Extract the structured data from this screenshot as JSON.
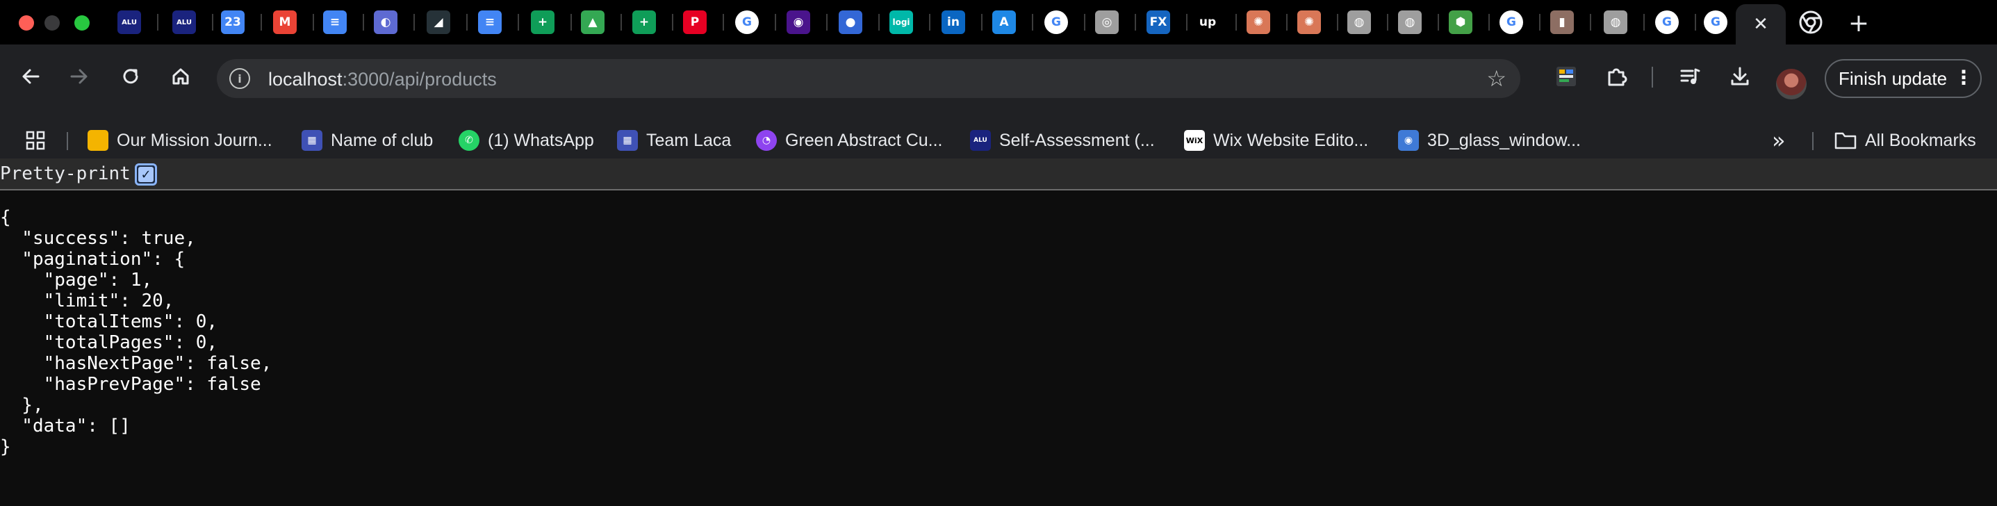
{
  "tabs": {
    "favicons": [
      {
        "icon": "alu-tab-icon",
        "glyph": "ALU",
        "color": "#1a237e"
      },
      {
        "icon": "alu-tab-icon",
        "glyph": "ALU",
        "color": "#1a237e"
      },
      {
        "icon": "calendar-tab-icon",
        "glyph": "23",
        "color": "#4285f4"
      },
      {
        "icon": "gmail-tab-icon",
        "glyph": "M",
        "color": "#ea4335"
      },
      {
        "icon": "docs-tab-icon",
        "glyph": "≡",
        "color": "#4285f4"
      },
      {
        "icon": "linear-tab-icon",
        "glyph": "◐",
        "color": "#5e6ad2"
      },
      {
        "icon": "alu-tab-icon",
        "glyph": "◢",
        "color": "#263238"
      },
      {
        "icon": "docs-tab-icon",
        "glyph": "≡",
        "color": "#4285f4"
      },
      {
        "icon": "sheets-tab-icon",
        "glyph": "+",
        "color": "#0f9d58"
      },
      {
        "icon": "drive-tab-icon",
        "glyph": "▲",
        "color": "#34a853"
      },
      {
        "icon": "sheets-tab-icon",
        "glyph": "+",
        "color": "#0f9d58"
      },
      {
        "icon": "pinterest-tab-icon",
        "glyph": "P",
        "color": "#e60023"
      },
      {
        "icon": "google-tab-icon",
        "glyph": "G",
        "color": "#ffffff"
      },
      {
        "icon": "circle-tab-icon",
        "glyph": "◉",
        "color": "#4a148c"
      },
      {
        "icon": "extension-tab-icon",
        "glyph": "●",
        "color": "#3367d6"
      },
      {
        "icon": "logi-tab-icon",
        "glyph": "logi",
        "color": "#00b8a9"
      },
      {
        "icon": "linkedin-tab-icon",
        "glyph": "in",
        "color": "#0a66c2"
      },
      {
        "icon": "arc-tab-icon",
        "glyph": "A",
        "color": "#1e88e5"
      },
      {
        "icon": "google-tab-icon",
        "glyph": "G",
        "color": "#ffffff"
      },
      {
        "icon": "globe-tab-icon",
        "glyph": "◎",
        "color": "#9e9e9e"
      },
      {
        "icon": "fx-tab-icon",
        "glyph": "FX",
        "color": "#1565c0"
      },
      {
        "icon": "upwork-tab-icon",
        "glyph": "up",
        "color": "#000000"
      },
      {
        "icon": "claude-tab-icon",
        "glyph": "✺",
        "color": "#d97757"
      },
      {
        "icon": "claude-tab-icon",
        "glyph": "✺",
        "color": "#d97757"
      },
      {
        "icon": "globe-tab-icon",
        "glyph": "◍",
        "color": "#9e9e9e"
      },
      {
        "icon": "globe-tab-icon",
        "glyph": "◍",
        "color": "#9e9e9e"
      },
      {
        "icon": "node-tab-icon",
        "glyph": "⬢",
        "color": "#43a047"
      },
      {
        "icon": "google-tab-icon",
        "glyph": "G",
        "color": "#ffffff"
      },
      {
        "icon": "bottle-tab-icon",
        "glyph": "▮",
        "color": "#8d6e63"
      },
      {
        "icon": "globe-tab-icon",
        "glyph": "◍",
        "color": "#9e9e9e"
      },
      {
        "icon": "google-tab-icon",
        "glyph": "G",
        "color": "#ffffff"
      },
      {
        "icon": "google-tab-icon",
        "glyph": "G",
        "color": "#ffffff"
      }
    ],
    "active_close": "✕",
    "new_tab": "+"
  },
  "toolbar": {
    "url_host": "localhost",
    "url_path": ":3000/api/products",
    "finish_update": "Finish update"
  },
  "bookmarks": {
    "items": [
      {
        "label": "Our Mission Journ...",
        "icon": "slides-icon",
        "color": "#f4b400"
      },
      {
        "label": "Name of club",
        "icon": "forms-icon",
        "color": "#3f51b5"
      },
      {
        "label": "(1) WhatsApp",
        "icon": "whatsapp-icon",
        "color": "#25d366"
      },
      {
        "label": "Team Laca",
        "icon": "forms-icon",
        "color": "#3f51b5"
      },
      {
        "label": "Green Abstract Cu...",
        "icon": "canva-icon",
        "color": "#8e44ef"
      },
      {
        "label": "Self-Assessment (...",
        "icon": "alu-icon",
        "color": "#1a237e"
      },
      {
        "label": "Wix Website Edito...",
        "icon": "wix-icon",
        "color": "#ffffff"
      },
      {
        "label": "3D_glass_window...",
        "icon": "tinkercad-icon",
        "color": "#3f7ad6"
      }
    ],
    "more": "»",
    "all_bookmarks": "All Bookmarks"
  },
  "content": {
    "pretty_print_label": "Pretty-print",
    "pretty_print_checked": true,
    "json_lines": [
      "{",
      "  \"success\": true,",
      "  \"pagination\": {",
      "    \"page\": 1,",
      "    \"limit\": 20,",
      "    \"totalItems\": 0,",
      "    \"totalPages\": 0,",
      "    \"hasNextPage\": false,",
      "    \"hasPrevPage\": false",
      "  },",
      "  \"data\": []",
      "}"
    ]
  }
}
